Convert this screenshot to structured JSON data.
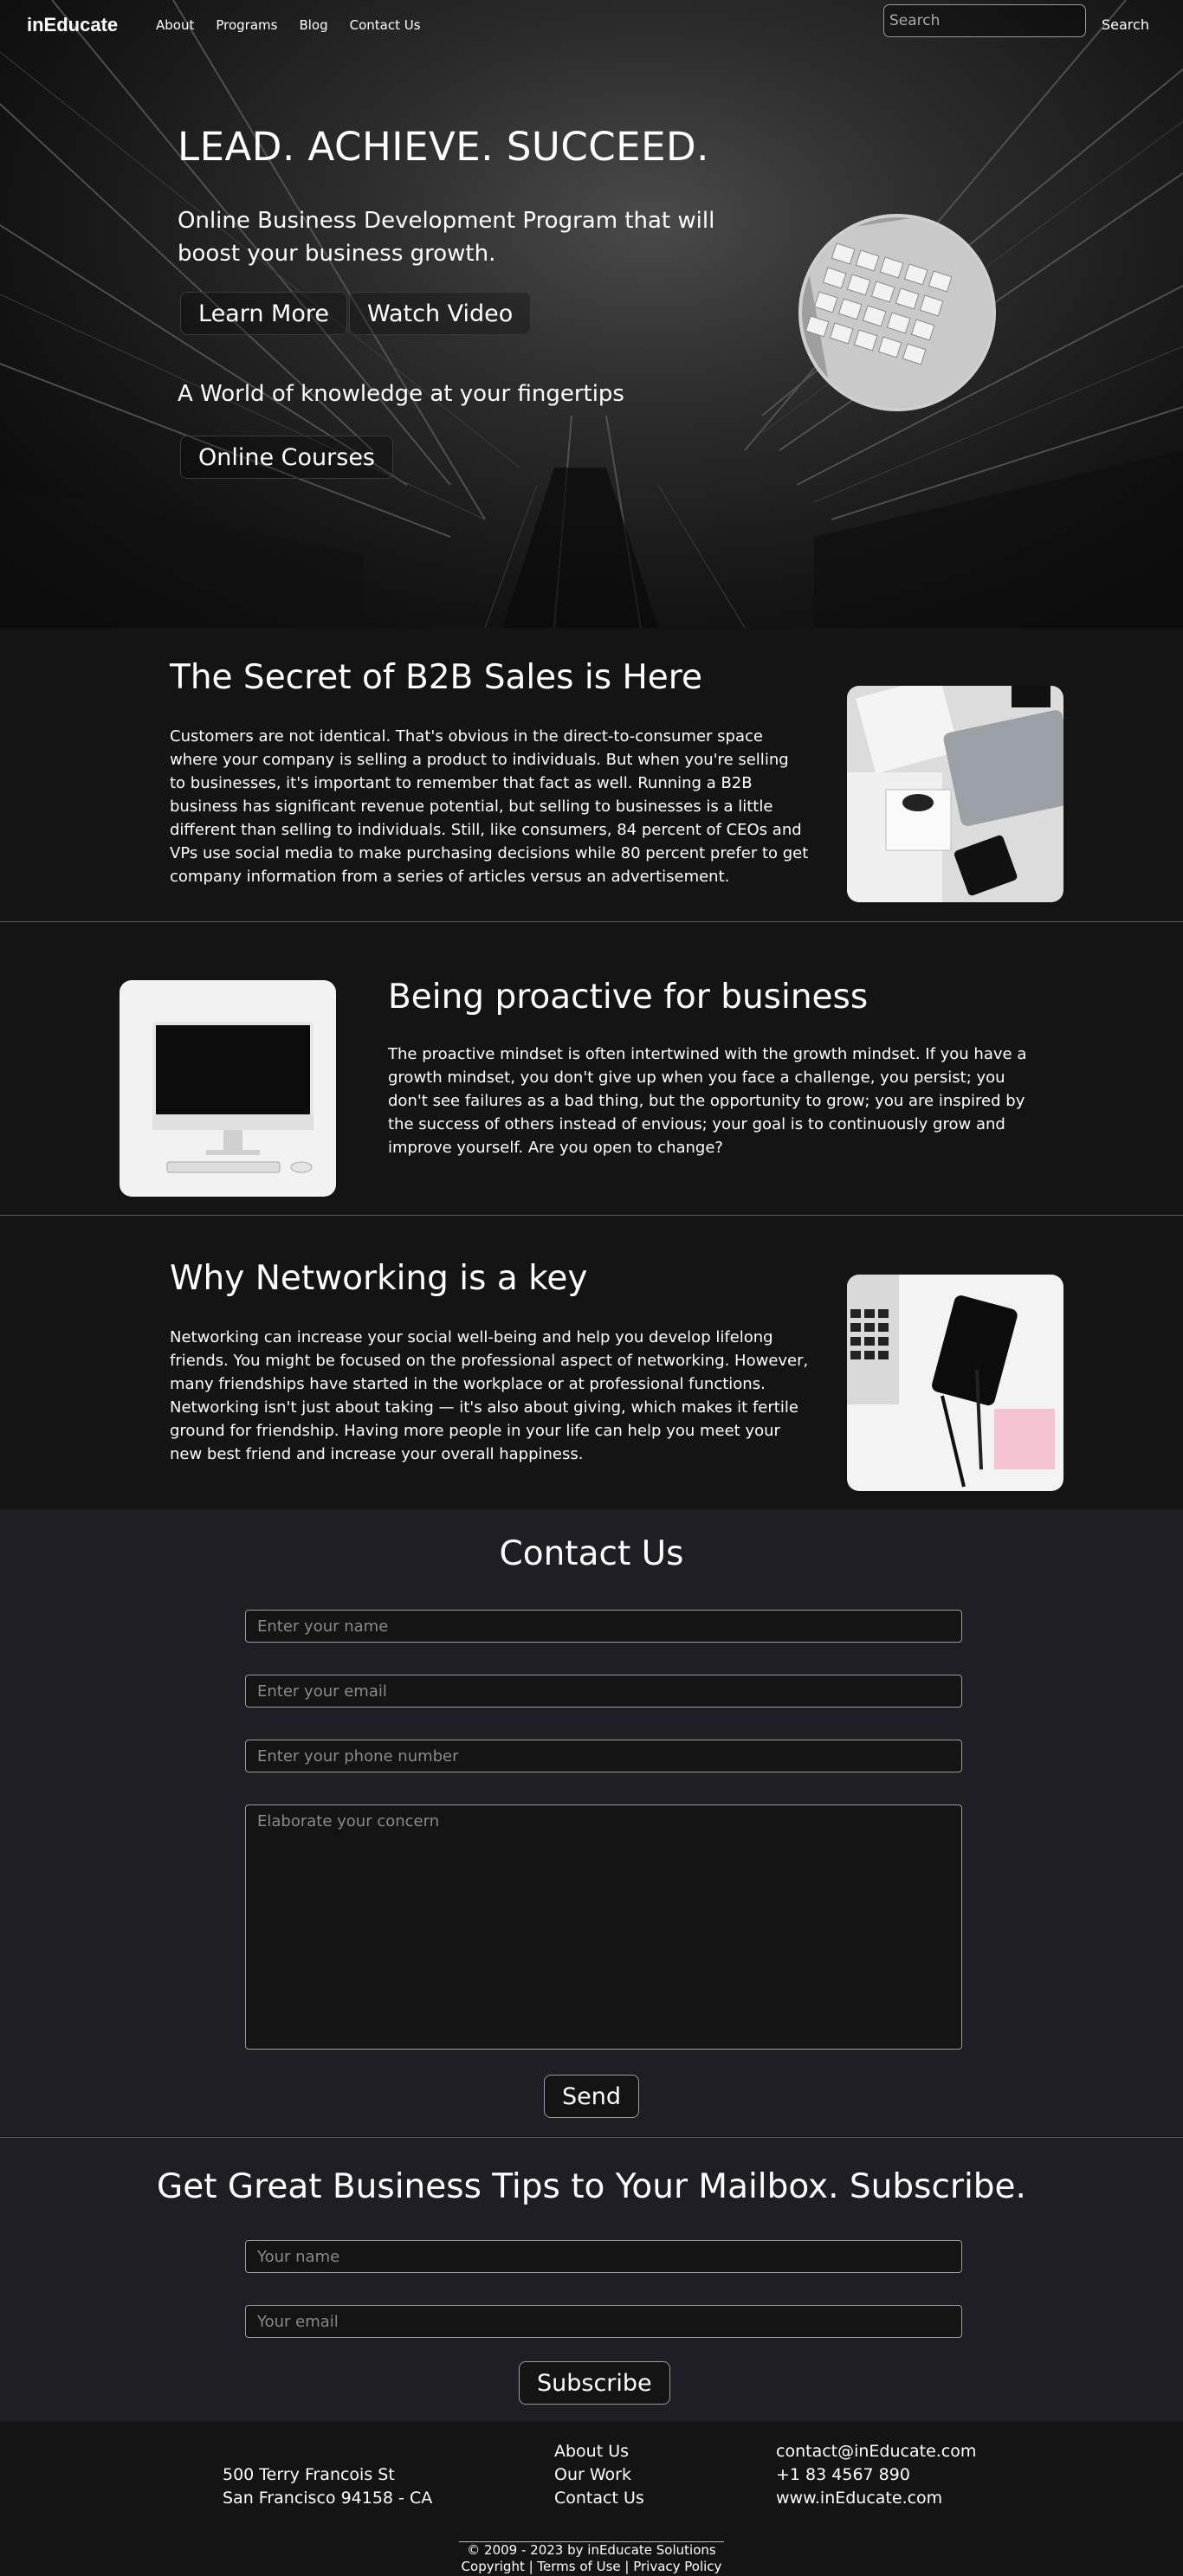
{
  "nav": {
    "brand": "inEducate",
    "links": [
      "About",
      "Programs",
      "Blog",
      "Contact Us"
    ],
    "search_placeholder": "Search",
    "search_button": "Search"
  },
  "hero": {
    "title": "LEAD. ACHIEVE. SUCCEED.",
    "subtitle": "Online Business Development Program that will boost your business growth.",
    "learn_more": "Learn More",
    "watch_video": "Watch Video",
    "tagline": "A World of knowledge at your fingertips",
    "online_courses": "Online Courses"
  },
  "articles": [
    {
      "title": "The Secret of B2B Sales is Here",
      "body": "Customers are not identical. That's obvious in the direct-to-consumer space where your company is selling a product to individuals. But when you're selling to businesses, it's important to remember that fact as well. Running a B2B business has significant revenue potential, but selling to businesses is a little different than selling to individuals. Still, like consumers, 84 percent of CEOs and VPs use social media to make purchasing decisions while 80 percent prefer to get company information from a series of articles versus an advertisement."
    },
    {
      "title": "Being proactive for business",
      "body": "The proactive mindset is often intertwined with the growth mindset. If you have a growth mindset, you don't give up when you face a challenge, you persist; you don't see failures as a bad thing, but the opportunity to grow; you are inspired by the success of others instead of envious; your goal is to continuously grow and improve yourself. Are you open to change?"
    },
    {
      "title": "Why Networking is a key",
      "body": "Networking can increase your social well-being and help you develop lifelong friends. You might be focused on the professional aspect of networking. However, many friendships have started in the workplace or at professional functions. Networking isn't just about taking — it's also about giving, which makes it fertile ground for friendship. Having more people in your life can help you meet your new best friend and increase your overall happiness."
    }
  ],
  "contact": {
    "title": "Contact Us",
    "name_placeholder": "Enter your name",
    "email_placeholder": "Enter your email",
    "phone_placeholder": "Enter your phone number",
    "concern_placeholder": "Elaborate your concern",
    "send": "Send"
  },
  "subscribe": {
    "title": "Get Great Business Tips to Your Mailbox. Subscribe.",
    "name_placeholder": "Your name",
    "email_placeholder": "Your email",
    "button": "Subscribe"
  },
  "footer": {
    "address_line1": "500 Terry Francois St",
    "address_line2": "San Francisco 94158 - CA",
    "links": [
      "About Us",
      "Our Work",
      "Contact Us"
    ],
    "email": "contact@inEducate.com",
    "phone": "+1 83 4567 890",
    "website": "www.inEducate.com",
    "copyright": "© 2009 - 2023 by inEducate Solutions",
    "legal": "Copyright | Terms of Use | Privacy Policy"
  },
  "colors": {
    "background": "#141414",
    "contact_background": "#1f1e24",
    "text": "#ffffff"
  }
}
